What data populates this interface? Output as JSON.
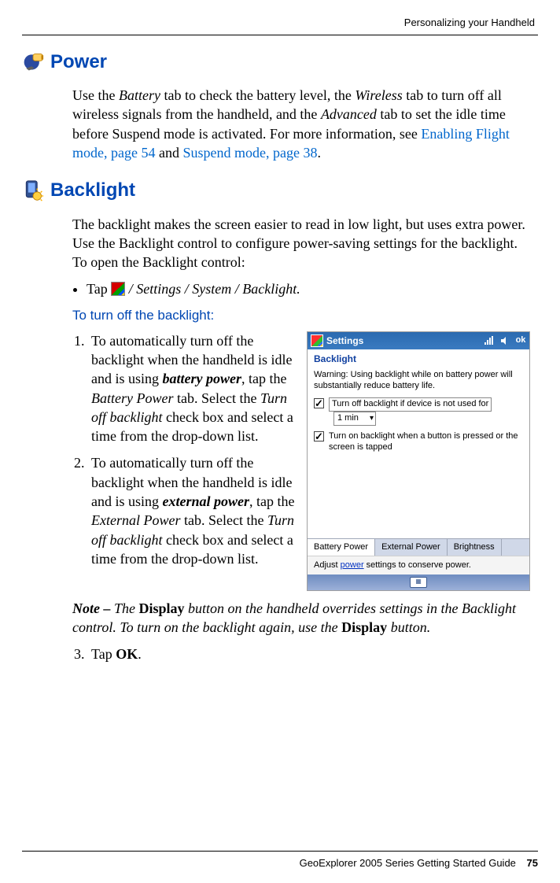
{
  "running_head": "Personalizing your Handheld",
  "sections": {
    "power": {
      "title": "Power",
      "body_pre": "Use the ",
      "i1": "Battery",
      "body_mid1": " tab to check the battery level, the ",
      "i2": "Wireless",
      "body_mid2": " tab to turn off all wireless signals from the handheld, and the ",
      "i3": "Advanced",
      "body_mid3": " tab to set the idle time before Suspend mode is activated. For more information, see ",
      "link1": "Enabling Flight mode, page 54",
      "body_and": " and ",
      "link2": "Suspend mode, page 38",
      "body_end": "."
    },
    "backlight": {
      "title": "Backlight",
      "intro": "The backlight makes the screen easier to read in low light, but uses extra power. Use the Backlight control to configure power-saving settings for the backlight. To open the Backlight control:",
      "bullet_pre": "Tap ",
      "bullet_post": " / Settings / System / Backlight.",
      "subhead": "To turn off the backlight:",
      "step1_pre": "To automatically turn off the backlight when the handheld is idle and is using ",
      "step1_bold": "battery power",
      "step1_mid": ", tap the ",
      "step1_i1": "Battery Power",
      "step1_mid2": " tab. Select the ",
      "step1_i2": "Turn off backlight",
      "step1_end": " check box and select a time from the drop-down list.",
      "step2_pre": "To automatically turn off the backlight when the handheld is idle and is using ",
      "step2_bold": "external power",
      "step2_mid": ", tap the ",
      "step2_i1": "External Power",
      "step2_mid2": " tab. Select the ",
      "step2_i2": "Turn off backlight",
      "step2_end": " check box and select a time from the drop-down list.",
      "note_pre": "Note – ",
      "note_body1": "The ",
      "note_bold1": "Display",
      "note_body2": " button on the handheld overrides settings in the Backlight control. To turn on the backlight again, use the ",
      "note_bold2": "Display",
      "note_body3": " button.",
      "step3_pre": "Tap ",
      "step3_bold": "OK",
      "step3_end": "."
    }
  },
  "screenshot": {
    "title": "Settings",
    "ok": "ok",
    "subtitle": "Backlight",
    "warn": "Warning: Using backlight while on battery power will substantially reduce battery life.",
    "check1": "Turn off backlight if device is not used for",
    "dropdown": "1 min",
    "check2": "Turn on backlight when a button is pressed or the screen is tapped",
    "tabs": [
      "Battery Power",
      "External Power",
      "Brightness"
    ],
    "footer_pre": "Adjust ",
    "footer_link": "power",
    "footer_post": " settings to conserve power."
  },
  "footer": {
    "text": "GeoExplorer 2005 Series Getting Started Guide",
    "page": "75"
  }
}
